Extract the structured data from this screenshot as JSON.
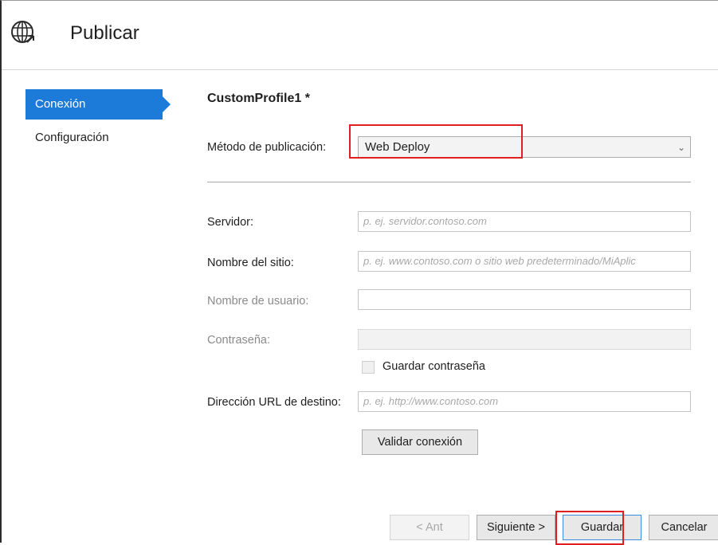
{
  "window": {
    "title": "Publicar",
    "icon": "globe-publish-icon"
  },
  "sidebar": {
    "items": [
      {
        "label": "Conexión",
        "active": true
      },
      {
        "label": "Configuración",
        "active": false
      }
    ]
  },
  "profile": {
    "name": "CustomProfile1 *"
  },
  "form": {
    "method": {
      "label": "Método de publicación:",
      "value": "Web Deploy"
    },
    "server": {
      "label": "Servidor:",
      "placeholder": "p. ej. servidor.contoso.com"
    },
    "site": {
      "label": "Nombre del sitio:",
      "placeholder": "p. ej. www.contoso.com o sitio web predeterminado/MiAplic"
    },
    "username": {
      "label": "Nombre de usuario:",
      "value": ""
    },
    "password": {
      "label": "Contraseña:",
      "value": ""
    },
    "save_password": {
      "label": "Guardar contraseña",
      "checked": false
    },
    "destination_url": {
      "label": "Dirección URL de destino:",
      "placeholder": "p. ej. http://www.contoso.com"
    },
    "validate_button": "Validar conexión"
  },
  "footer": {
    "prev": "< Ant",
    "next": "Siguiente >",
    "save": "Guardar",
    "cancel": "Cancelar"
  },
  "colors": {
    "accent": "#1c7bd9",
    "highlight": "#e02020"
  }
}
